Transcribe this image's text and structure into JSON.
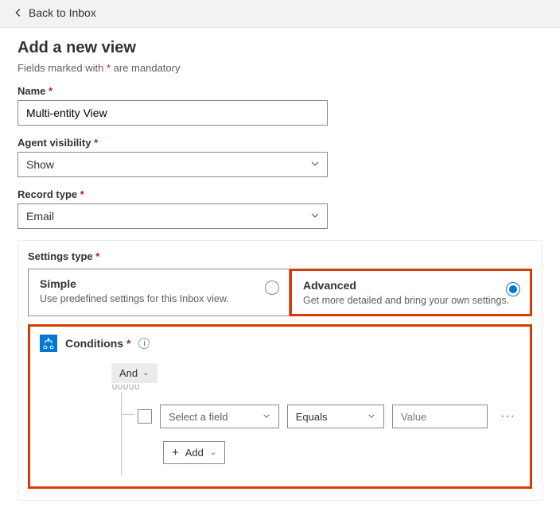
{
  "back_link": "Back to Inbox",
  "title": "Add a new view",
  "subhead_prefix": "Fields marked with ",
  "subhead_suffix": " are mandatory",
  "asterisk": "*",
  "fields": {
    "name": {
      "label": "Name",
      "value": "Multi-entity View"
    },
    "agent_visibility": {
      "label": "Agent visibility",
      "value": "Show"
    },
    "record_type": {
      "label": "Record type",
      "value": "Email"
    }
  },
  "settings_type": {
    "label": "Settings type",
    "simple": {
      "title": "Simple",
      "desc": "Use predefined settings for this Inbox view.",
      "selected": false
    },
    "advanced": {
      "title": "Advanced",
      "desc": "Get more detailed and bring your own settings.",
      "selected": true
    }
  },
  "conditions": {
    "title": "Conditions",
    "group_op": "And",
    "row": {
      "field_placeholder": "Select a field",
      "operator": "Equals",
      "value_placeholder": "Value"
    },
    "add_label": "Add"
  }
}
